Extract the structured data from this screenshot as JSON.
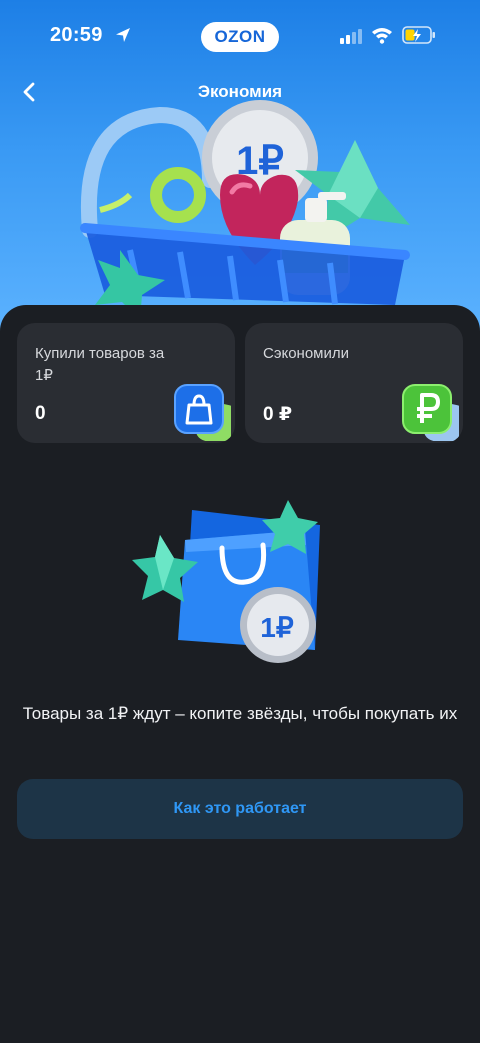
{
  "status_bar": {
    "time": "20:59",
    "brand": "OZON"
  },
  "header": {
    "title": "Экономия",
    "back_icon": "chevron-left-icon"
  },
  "stats": [
    {
      "label": "Купили товаров за 1₽",
      "value": "0",
      "icon": "shopping-bag-icon"
    },
    {
      "label": "Сэкономили",
      "value": "0 ₽",
      "icon": "ruble-icon"
    }
  ],
  "promo": {
    "coin_text": "1₽",
    "text": "Товары за 1₽ ждут – копите звёзды, чтобы покупать их"
  },
  "button": {
    "label": "Как это работает"
  },
  "colors": {
    "hero_blue": "#1d7fe6",
    "background": "#1b1e23",
    "card": "#2a2d33",
    "accent": "#2f97f5",
    "button_bg": "#1d3447",
    "green": "#4cc33a"
  }
}
